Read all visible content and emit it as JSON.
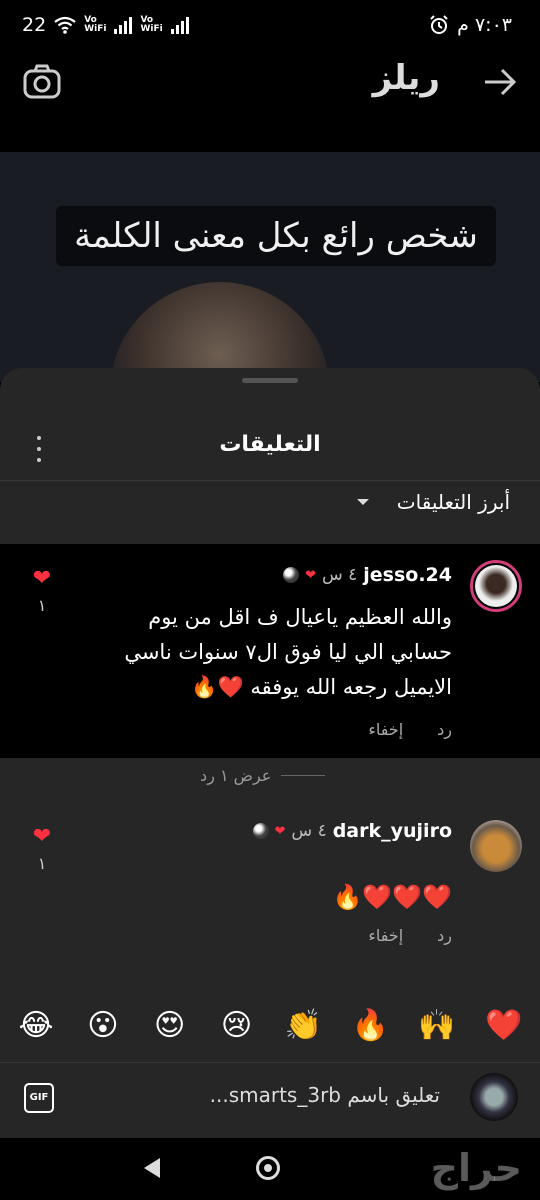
{
  "status_bar": {
    "battery": "22",
    "vo_top": "Vo",
    "vo_bottom": "WiFi",
    "time": "٧:٠٣ م"
  },
  "header": {
    "title": "ريلز"
  },
  "video": {
    "caption": "شخص رائع بكل معنى الكلمة"
  },
  "sheet": {
    "title": "التعليقات",
    "sort_label": "أبرز التعليقات"
  },
  "comments": [
    {
      "username": "jesso.24",
      "time": "٤ س",
      "text": "والله العظيم ياعيال ف اقل من يوم حسابي الي ليا فوق ال٧ سنوات ناسي الايميل رجعه الله يوفقه ❤️🔥",
      "reply_label": "رد",
      "hide_label": "إخفاء",
      "like_count": "١"
    },
    {
      "username": "dark_yujiro",
      "time": "٤ س",
      "text": "❤️❤️❤️🔥",
      "reply_label": "رد",
      "hide_label": "إخفاء",
      "like_count": "١"
    }
  ],
  "view_replies": "عرض ١ رد",
  "emojis": [
    "❤️",
    "🙌",
    "🔥",
    "👏",
    "😢",
    "😍",
    "😮",
    "😂"
  ],
  "input": {
    "placeholder": "تعليق باسم smarts_3rb...",
    "gif_label": "GIF"
  },
  "watermark": "حراج",
  "colors": {
    "heart": "#ff3040",
    "sheet_bg": "#262626",
    "story_ring": "#d03d7a"
  }
}
